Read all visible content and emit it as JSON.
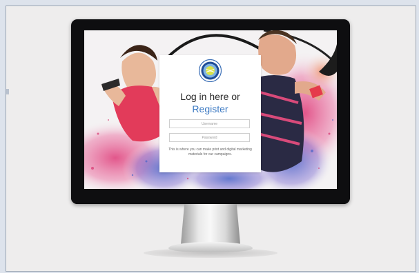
{
  "login": {
    "heading": "Log in here or",
    "register_link": "Register",
    "username_placeholder": "Username",
    "password_placeholder": "Password",
    "tagline": "This is where you can make print and digital marketing materials for our campaigns."
  },
  "icons": {
    "logo": "tennis-ball-crest-icon"
  },
  "colors": {
    "link": "#3a78c2",
    "page_background": "#dde3ec",
    "monitor_bezel": "#0e0e10",
    "splash_pink": "#e0457f",
    "splash_blue": "#4a64c8"
  }
}
